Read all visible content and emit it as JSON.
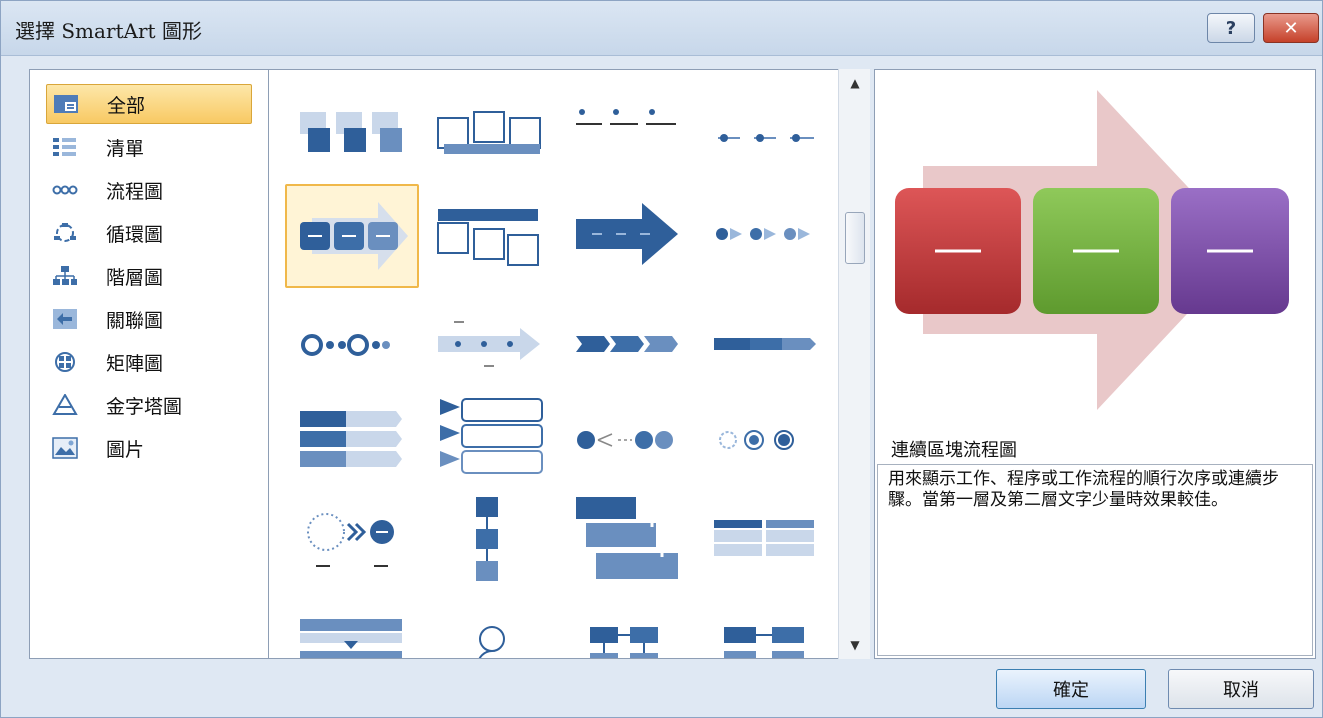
{
  "dialog": {
    "title": "選擇 SmartArt 圖形",
    "help_label": "?",
    "close_label": "✕"
  },
  "categories": [
    {
      "label": "全部",
      "icon": "all-icon",
      "selected": true
    },
    {
      "label": "清單",
      "icon": "list-icon"
    },
    {
      "label": "流程圖",
      "icon": "process-icon"
    },
    {
      "label": "循環圖",
      "icon": "cycle-icon"
    },
    {
      "label": "階層圖",
      "icon": "hierarchy-icon"
    },
    {
      "label": "關聯圖",
      "icon": "relationship-icon"
    },
    {
      "label": "矩陣圖",
      "icon": "matrix-icon"
    },
    {
      "label": "金字塔圖",
      "icon": "pyramid-icon"
    },
    {
      "label": "圖片",
      "icon": "picture-icon"
    }
  ],
  "preview": {
    "title": "連續區塊流程圖",
    "description": "用來顯示工作、程序或工作流程的順行次序或連續步驟。當第一層及第二層文字少量時效果較佳。",
    "colors": {
      "box1": "#c0393b",
      "box2": "#6fae3a",
      "box3": "#7c50a8",
      "arrow": "#e9c8c9"
    }
  },
  "buttons": {
    "ok": "確定",
    "cancel": "取消"
  },
  "colors": {
    "accent": "#4a78b0",
    "selection": "#f8c963"
  }
}
